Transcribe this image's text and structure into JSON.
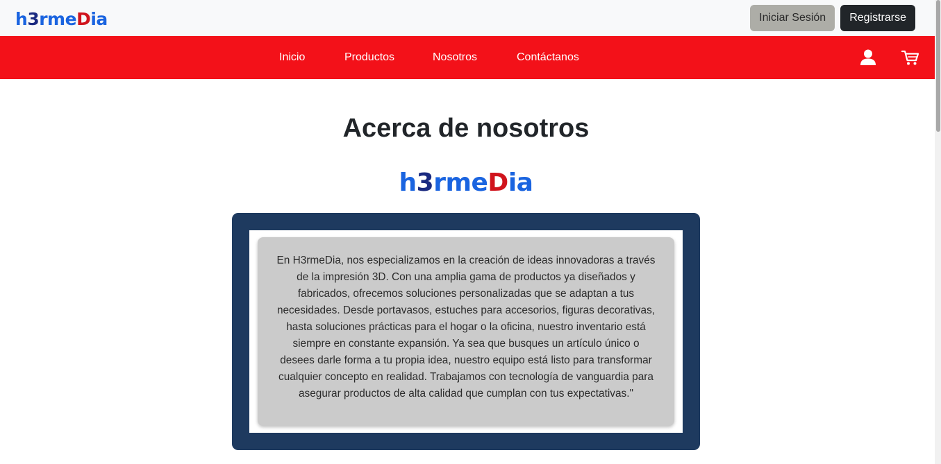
{
  "brand": {
    "logo_parts": [
      "h",
      "3",
      "rme",
      "D",
      "ia"
    ]
  },
  "header": {
    "login_label": "Iniciar Sesión",
    "register_label": "Registrarse"
  },
  "nav": {
    "items": [
      {
        "label": "Inicio"
      },
      {
        "label": "Productos"
      },
      {
        "label": "Nosotros"
      },
      {
        "label": "Contáctanos"
      }
    ],
    "icons": [
      "user-icon",
      "cart-icon"
    ]
  },
  "main": {
    "title": "Acerca de nosotros",
    "about_text": "En H3rmeDia, nos especializamos en la creación de ideas innovadoras a través de la impresión 3D. Con una amplia gama de productos ya diseñados y fabricados, ofrecemos soluciones personalizadas que se adaptan a tus necesidades. Desde portavasos, estuches para accesorios, figuras decorativas, hasta soluciones prácticas para el hogar o la oficina, nuestro inventario está siempre en constante expansión. Ya sea que busques un artículo único o desees darle forma a tu propia idea, nuestro equipo está listo para transformar cualquier concepto en realidad. Trabajamos con tecnología de vanguardia para asegurar productos de alta calidad que cumplan con tus expectativas.\""
  },
  "colors": {
    "nav_background": "#f31119",
    "topbar_background": "#f8f9fa",
    "frame_background": "#1e3a5f",
    "card_background": "#cbcbcb",
    "logo_blue": "#1a64e0",
    "logo_red": "#d0141d"
  }
}
